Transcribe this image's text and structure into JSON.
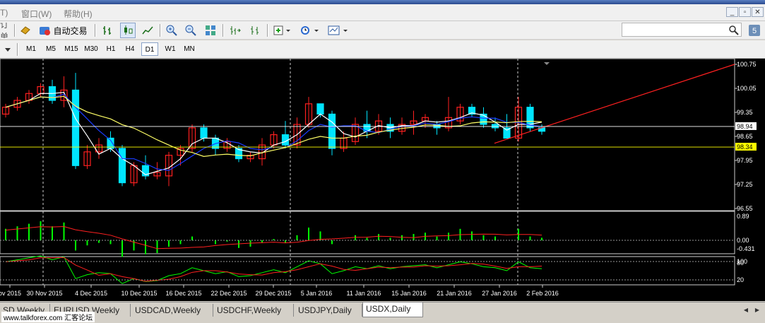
{
  "menu": {
    "items": [
      "T)",
      "窗口(W)",
      "帮助(H)"
    ]
  },
  "toolbar": {
    "orders_label": "订单",
    "autotrade_label": "自动交易",
    "search_value": ""
  },
  "timeframes": {
    "items": [
      "M1",
      "M5",
      "M15",
      "M30",
      "H1",
      "H4",
      "D1",
      "W1",
      "MN"
    ],
    "selected": "D1"
  },
  "tabs": {
    "items": [
      "SD,Weekly",
      "EURUSD,Weekly",
      "USDCAD,Weekly",
      "USDCHF,Weekly",
      "USDJPY,Daily",
      "USDX,Daily"
    ],
    "active": "USDX,Daily"
  },
  "watermark": "www.talkforex.com 汇客论坛",
  "colors": {
    "background": "#000000",
    "bull": "#00e5ff",
    "bear": "#ff2020",
    "ma_blue": "#1a3cff",
    "ma_white": "#ffffff",
    "ma_yellow": "#ffff66",
    "trend": "#ff2020"
  },
  "chart_data": {
    "type": "candlestick",
    "symbol": "USDX",
    "timeframe": "Daily",
    "price_axis": {
      "ticks": [
        "100.75",
        "100.05",
        "99.35",
        "98.65",
        "97.95",
        "97.25",
        "96.55"
      ],
      "ylim": [
        96.55,
        100.75
      ]
    },
    "price_labels": [
      {
        "text": "98.94",
        "value": 98.94,
        "color": "#ffffff"
      },
      {
        "text": "98.34",
        "value": 98.34,
        "color": "#ffff00"
      }
    ],
    "date_labels": [
      "ov 2015",
      "30 Nov 2015",
      "4 Dec 2015",
      "10 Dec 2015",
      "16 Dec 2015",
      "22 Dec 2015",
      "29 Dec 2015",
      "5 Jan 2016",
      "11 Jan 2016",
      "15 Jan 2016",
      "21 Jan 2016",
      "27 Jan 2016",
      "2 Feb 2016"
    ],
    "candles": [
      [
        99.3,
        99.6,
        99.2,
        99.5
      ],
      [
        99.5,
        99.8,
        99.4,
        99.7
      ],
      [
        99.7,
        100.0,
        99.6,
        99.9
      ],
      [
        99.9,
        100.2,
        99.8,
        100.1
      ],
      [
        100.1,
        100.3,
        99.6,
        99.7
      ],
      [
        99.7,
        100.4,
        99.5,
        100.0
      ],
      [
        100.0,
        100.5,
        97.7,
        97.8
      ],
      [
        97.8,
        98.4,
        97.7,
        98.2
      ],
      [
        98.2,
        98.6,
        98.0,
        98.4
      ],
      [
        98.6,
        98.8,
        98.2,
        98.3
      ],
      [
        98.3,
        98.4,
        97.2,
        97.3
      ],
      [
        97.3,
        97.9,
        97.2,
        97.8
      ],
      [
        97.8,
        98.1,
        97.4,
        97.5
      ],
      [
        97.5,
        97.9,
        97.4,
        97.6
      ],
      [
        97.5,
        98.2,
        97.2,
        98.1
      ],
      [
        98.1,
        98.4,
        97.8,
        98.3
      ],
      [
        98.3,
        99.0,
        98.2,
        98.9
      ],
      [
        98.9,
        99.0,
        98.5,
        98.6
      ],
      [
        98.6,
        98.7,
        98.1,
        98.3
      ],
      [
        98.3,
        98.6,
        98.2,
        98.5
      ],
      [
        98.3,
        98.4,
        97.9,
        98.0
      ],
      [
        98.0,
        98.2,
        97.9,
        98.1
      ],
      [
        98.0,
        98.6,
        97.8,
        98.4
      ],
      [
        98.4,
        98.8,
        98.3,
        98.7
      ],
      [
        98.7,
        99.1,
        98.3,
        98.4
      ],
      [
        98.4,
        99.2,
        98.3,
        99.0
      ],
      [
        99.0,
        99.8,
        98.9,
        99.6
      ],
      [
        99.6,
        99.5,
        99.2,
        99.3
      ],
      [
        99.3,
        99.4,
        98.1,
        98.3
      ],
      [
        98.3,
        98.8,
        98.2,
        98.6
      ],
      [
        98.5,
        99.2,
        98.4,
        99.0
      ],
      [
        99.0,
        99.4,
        98.6,
        98.8
      ],
      [
        98.8,
        99.3,
        98.7,
        99.1
      ],
      [
        99.0,
        99.2,
        98.6,
        98.8
      ],
      [
        98.8,
        99.2,
        98.7,
        99.0
      ],
      [
        99.0,
        99.4,
        98.7,
        99.1
      ],
      [
        99.1,
        99.3,
        98.9,
        99.2
      ],
      [
        99.0,
        99.1,
        98.7,
        98.9
      ],
      [
        98.9,
        99.8,
        98.8,
        99.2
      ],
      [
        99.1,
        99.6,
        99.0,
        99.5
      ],
      [
        99.5,
        99.6,
        99.2,
        99.3
      ],
      [
        99.3,
        99.5,
        98.9,
        99.0
      ],
      [
        99.0,
        99.2,
        98.8,
        98.9
      ],
      [
        98.9,
        99.3,
        98.6,
        98.6
      ],
      [
        98.6,
        99.8,
        98.5,
        99.5
      ],
      [
        99.5,
        99.6,
        98.8,
        98.9
      ],
      [
        98.9,
        99.0,
        98.7,
        98.8
      ]
    ],
    "indicator1": {
      "axis_ticks": [
        "0.89",
        "0.00",
        "-0.431"
      ]
    },
    "indicator2": {
      "axis_ticks": [
        "100",
        "80",
        "20"
      ]
    }
  }
}
